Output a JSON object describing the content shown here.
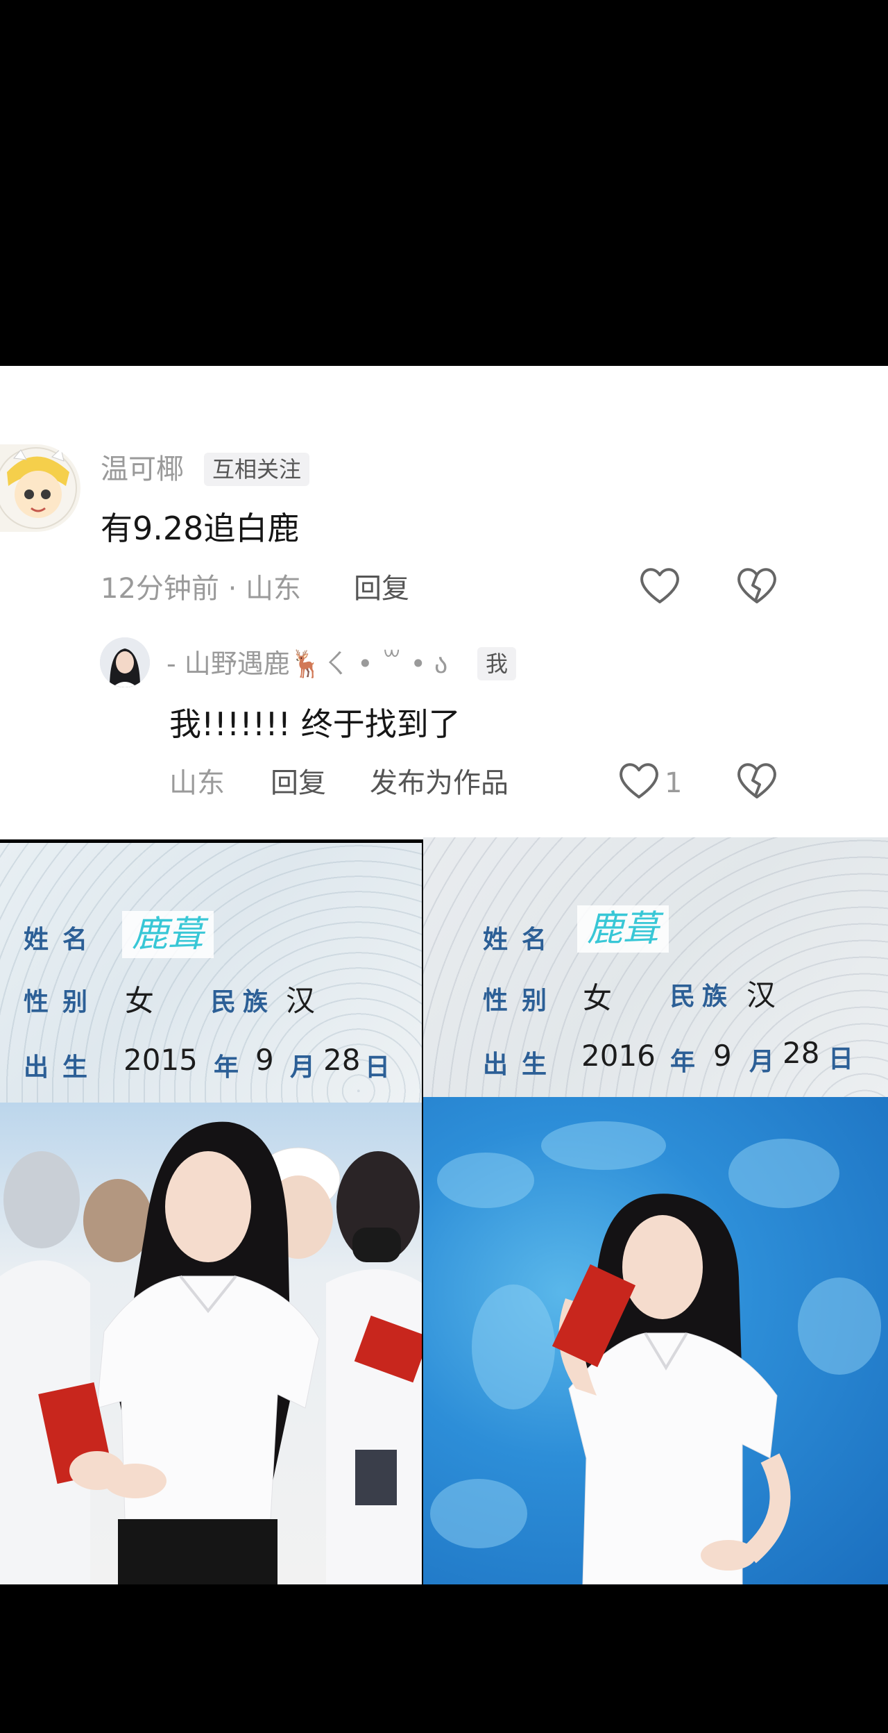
{
  "comment": {
    "username": "温可椰",
    "relation_tag": "互相关注",
    "text": "有9.28追白鹿",
    "time_location": "12分钟前 · 山东",
    "reply_label": "回复",
    "like_icon": "heart-outline-icon",
    "dislike_icon": "broken-heart-icon"
  },
  "reply": {
    "username": "- 山野遇鹿🦌ㄑ • ꒳ • ა",
    "self_tag": "我",
    "text": "我!!!!!!!  终于找到了",
    "location": "山东",
    "reply_label": "回复",
    "publish_label": "发布为作品",
    "like_count": "1"
  },
  "left_card": {
    "name_label": "姓名",
    "name_value": "鹿葺",
    "gender_label": "性别",
    "gender_value": "女",
    "ethnicity_label": "民族",
    "ethnicity_value": "汉",
    "birth_label": "出生",
    "year": "2015",
    "year_unit": "年",
    "month": "9",
    "month_unit": "月",
    "day": "28",
    "day_unit": "日"
  },
  "right_card": {
    "name_label": "姓名",
    "name_value": "鹿葺",
    "gender_label": "性别",
    "gender_value": "女",
    "ethnicity_label": "民族",
    "ethnicity_value": "汉",
    "birth_label": "出生",
    "year": "2016",
    "year_unit": "年",
    "month": "9",
    "month_unit": "月",
    "day": "28",
    "day_unit": "日"
  },
  "colors": {
    "id_label_blue": "#2c5f96",
    "name_cyan": "#38c7d6",
    "envelope_red": "#c8261d"
  }
}
